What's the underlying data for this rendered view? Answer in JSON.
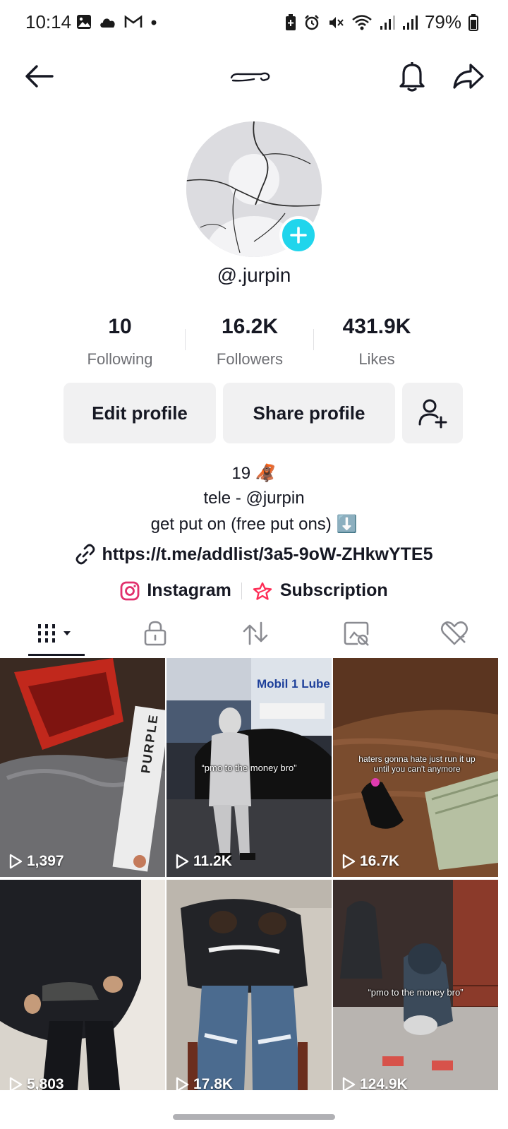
{
  "status_bar": {
    "time": "10:14",
    "battery": "79%",
    "left_icons": [
      "gallery-icon",
      "cloud-icon",
      "gmail-icon",
      "dot-icon"
    ],
    "right_icons": [
      "battery-saver-icon",
      "alarm-icon",
      "mute-icon",
      "wifi-icon",
      "signal-icon",
      "signal-icon",
      "battery-icon"
    ]
  },
  "profile": {
    "username": "@.jurpin"
  },
  "stats": {
    "following_count": "10",
    "following_label": "Following",
    "followers_count": "16.2K",
    "followers_label": "Followers",
    "likes_count": "431.9K",
    "likes_label": "Likes"
  },
  "actions": {
    "edit_profile": "Edit profile",
    "share_profile": "Share profile"
  },
  "bio": {
    "age": "19 🦧",
    "tele": "tele - @jurpin",
    "line3": "get put on (free put ons) ⬇️",
    "link": "https://t.me/addlist/3a5-9oW-ZHkwYTE5"
  },
  "social": {
    "instagram": "Instagram",
    "subscription": "Subscription"
  },
  "tabs": [
    "videos-grid-icon",
    "lock-icon",
    "repost-icon",
    "tagged-icon",
    "liked-icon"
  ],
  "videos": [
    {
      "views": "1,397",
      "overlay": "",
      "label": "PURPLE"
    },
    {
      "views": "11.2K",
      "overlay": "“pmo to the money bro”",
      "label": "Mobil 1 Lube"
    },
    {
      "views": "16.7K",
      "overlay": "haters gonna hate just run it up until you can't anymore",
      "label": ""
    },
    {
      "views": "5,803",
      "overlay": "",
      "label": ""
    },
    {
      "views": "17.8K",
      "overlay": "",
      "label": ""
    },
    {
      "views": "124.9K",
      "overlay": "“pmo to the money bro”",
      "label": ""
    }
  ],
  "colors": {
    "accent": "#20d5ec",
    "text": "#161823",
    "muted": "#6e6f74",
    "button_bg": "#f1f1f2",
    "instagram": "#e1306c",
    "subscription": "#fe2c55"
  }
}
